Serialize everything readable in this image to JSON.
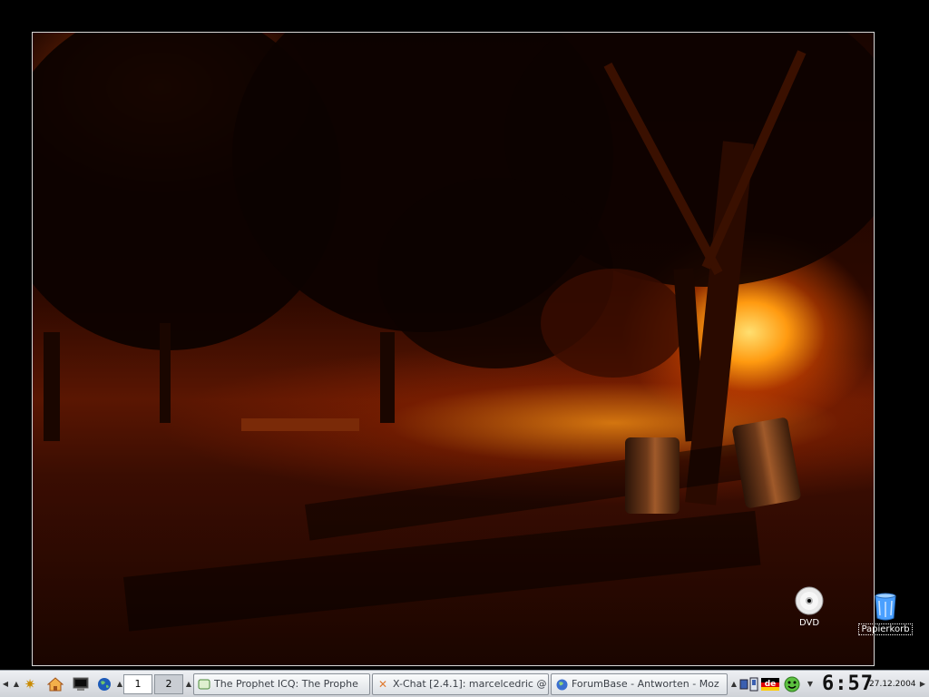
{
  "desktop": {
    "icons": [
      {
        "label": "DVD",
        "icon": "dvd-disc-icon"
      },
      {
        "label": "Papierkorb",
        "icon": "trash-bin-icon"
      }
    ],
    "wallpaper": "night-park-trees-orange-light"
  },
  "taskbar": {
    "launchers": [
      {
        "icon": "kde-menu-icon"
      },
      {
        "icon": "home-folder-icon"
      },
      {
        "icon": "terminal-icon"
      },
      {
        "icon": "web-browser-globe-icon"
      }
    ],
    "pager": [
      "1",
      "2"
    ],
    "tasks": [
      {
        "title": "The Prophet ICQ: The Prophe",
        "icon": "icq-chat-window-icon"
      },
      {
        "title": "X-Chat [2.4.1]: marcelcedric @",
        "icon": "xchat-icon"
      },
      {
        "title": "ForumBase - Antworten - Moz",
        "icon": "mozilla-globe-icon"
      }
    ],
    "tray": [
      {
        "icon": "network-monitor-icon"
      },
      {
        "icon": "keyboard-layout-flag-icon",
        "label": "de"
      },
      {
        "icon": "green-smiley-icon"
      }
    ],
    "clock": "6:57",
    "date": "27.12.2004"
  },
  "colors": {
    "taskbar_bg": "#dde1e6",
    "accent_orange": "#ff9a10"
  }
}
